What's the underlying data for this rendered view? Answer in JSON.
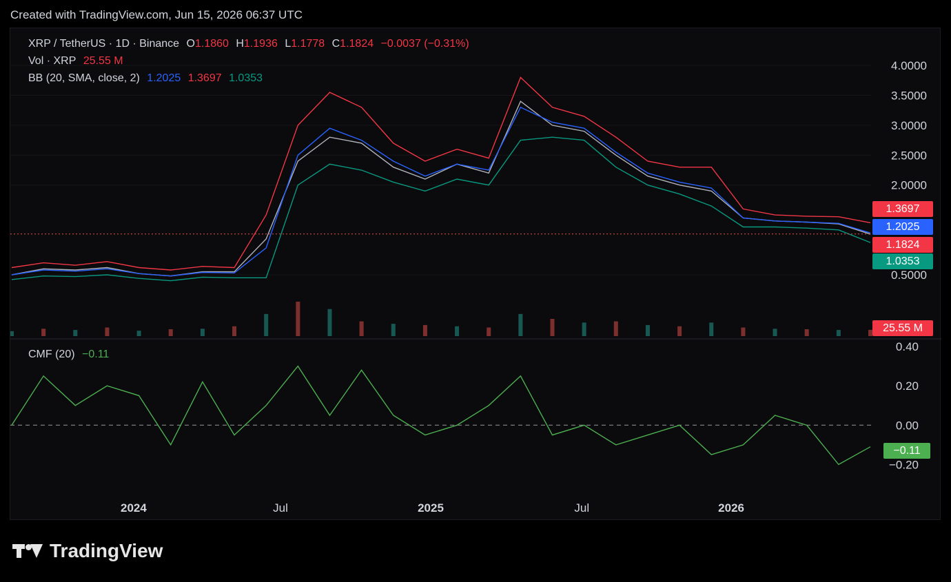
{
  "header": {
    "text": "Created with TradingView.com, Jun 15, 2026 06:37 UTC"
  },
  "legend": {
    "symbol": "XRP / TetherUS · 1D · Binance",
    "open_label": "O",
    "open": "1.1860",
    "high_label": "H",
    "high": "1.1936",
    "low_label": "L",
    "low": "1.1778",
    "close_label": "C",
    "close": "1.1824",
    "change": "−0.0037 (−0.31%)",
    "vol_label": "Vol · XRP",
    "vol": "25.55 M",
    "bb_label": "BB (20, SMA, close, 2)",
    "bb_basis": "1.2025",
    "bb_upper": "1.3697",
    "bb_lower": "1.0353",
    "cmf_label": "CMF (20)",
    "cmf": "−0.11"
  },
  "tags": {
    "upper": "1.3697",
    "basis": "1.2025",
    "close": "1.1824",
    "lower": "1.0353",
    "volume": "25.55 M",
    "cmf": "−0.11"
  },
  "brand": {
    "name": "TradingView",
    "icon": "tradingview-logo-icon"
  },
  "colors": {
    "up": "#26a69a",
    "down": "#ef5350",
    "upper": "#f23645",
    "basis": "#2962ff",
    "lower": "#089981",
    "cmf": "#4caf50",
    "tag_red": "#f23645",
    "tag_blue": "#2962ff",
    "tag_green": "#089981"
  },
  "chart_data": [
    {
      "type": "line",
      "title": "XRP / TetherUS · 1D · Binance",
      "y_axis": {
        "ticks": [
          "4.0000",
          "3.5000",
          "3.0000",
          "2.5000",
          "2.0000",
          "0.5000"
        ],
        "ylim": [
          0.2,
          4.3
        ]
      },
      "x_axis": {
        "ticks": [
          "2024",
          "Jul",
          "2025",
          "Jul",
          "2026"
        ]
      },
      "x": [
        "2023-09",
        "2023-11",
        "2024-01",
        "2024-03",
        "2024-05",
        "2024-07",
        "2024-09",
        "2024-10",
        "2024-11",
        "2024-12",
        "2025-01",
        "2025-02",
        "2025-03",
        "2025-04",
        "2025-05",
        "2025-06",
        "2025-07",
        "2025-08",
        "2025-09",
        "2025-10",
        "2025-11",
        "2025-12",
        "2026-01",
        "2026-02",
        "2026-03",
        "2026-04",
        "2026-05",
        "2026-06"
      ],
      "series": [
        {
          "name": "Close",
          "values": [
            0.5,
            0.6,
            0.58,
            0.62,
            0.52,
            0.48,
            0.55,
            0.55,
            1.1,
            2.4,
            2.8,
            2.7,
            2.3,
            2.1,
            2.35,
            2.2,
            3.4,
            3.0,
            2.9,
            2.5,
            2.15,
            2.0,
            1.9,
            1.45,
            1.4,
            1.38,
            1.35,
            1.18
          ]
        },
        {
          "name": "BB Upper",
          "values": [
            0.62,
            0.7,
            0.66,
            0.72,
            0.62,
            0.58,
            0.64,
            0.62,
            1.5,
            3.0,
            3.55,
            3.3,
            2.7,
            2.4,
            2.6,
            2.45,
            3.8,
            3.3,
            3.15,
            2.8,
            2.4,
            2.3,
            2.3,
            1.6,
            1.5,
            1.48,
            1.47,
            1.37
          ]
        },
        {
          "name": "BB Basis",
          "values": [
            0.5,
            0.58,
            0.56,
            0.6,
            0.52,
            0.48,
            0.54,
            0.53,
            0.95,
            2.5,
            2.95,
            2.75,
            2.4,
            2.15,
            2.35,
            2.25,
            3.3,
            3.05,
            2.95,
            2.55,
            2.2,
            2.05,
            1.95,
            1.45,
            1.4,
            1.38,
            1.36,
            1.2
          ]
        },
        {
          "name": "BB Lower",
          "values": [
            0.42,
            0.48,
            0.47,
            0.5,
            0.44,
            0.4,
            0.46,
            0.45,
            0.45,
            2.0,
            2.35,
            2.25,
            2.05,
            1.9,
            2.1,
            2.0,
            2.75,
            2.8,
            2.75,
            2.3,
            2.0,
            1.85,
            1.65,
            1.3,
            1.3,
            1.28,
            1.25,
            1.04
          ]
        }
      ],
      "volume": [
        20,
        30,
        25,
        35,
        22,
        28,
        30,
        40,
        90,
        140,
        110,
        60,
        50,
        45,
        40,
        35,
        90,
        70,
        55,
        60,
        45,
        40,
        55,
        35,
        30,
        28,
        25,
        25.55
      ],
      "last_close": 1.1824
    },
    {
      "type": "line",
      "title": "CMF (20)",
      "y_axis": {
        "ticks": [
          "0.40",
          "0.20",
          "0.00",
          "−0.20"
        ],
        "ylim": [
          -0.3,
          0.4
        ]
      },
      "x": [
        "2023-09",
        "2023-11",
        "2024-01",
        "2024-03",
        "2024-05",
        "2024-07",
        "2024-09",
        "2024-10",
        "2024-11",
        "2024-12",
        "2025-01",
        "2025-02",
        "2025-03",
        "2025-04",
        "2025-05",
        "2025-06",
        "2025-07",
        "2025-08",
        "2025-09",
        "2025-10",
        "2025-11",
        "2025-12",
        "2026-01",
        "2026-02",
        "2026-03",
        "2026-04",
        "2026-05",
        "2026-06"
      ],
      "series": [
        {
          "name": "CMF",
          "values": [
            0.0,
            0.25,
            0.1,
            0.2,
            0.15,
            -0.1,
            0.22,
            -0.05,
            0.1,
            0.3,
            0.05,
            0.28,
            0.05,
            -0.05,
            0.0,
            0.1,
            0.25,
            -0.05,
            0.0,
            -0.1,
            -0.05,
            0.0,
            -0.15,
            -0.1,
            0.05,
            0.0,
            -0.2,
            -0.11
          ]
        }
      ]
    }
  ]
}
